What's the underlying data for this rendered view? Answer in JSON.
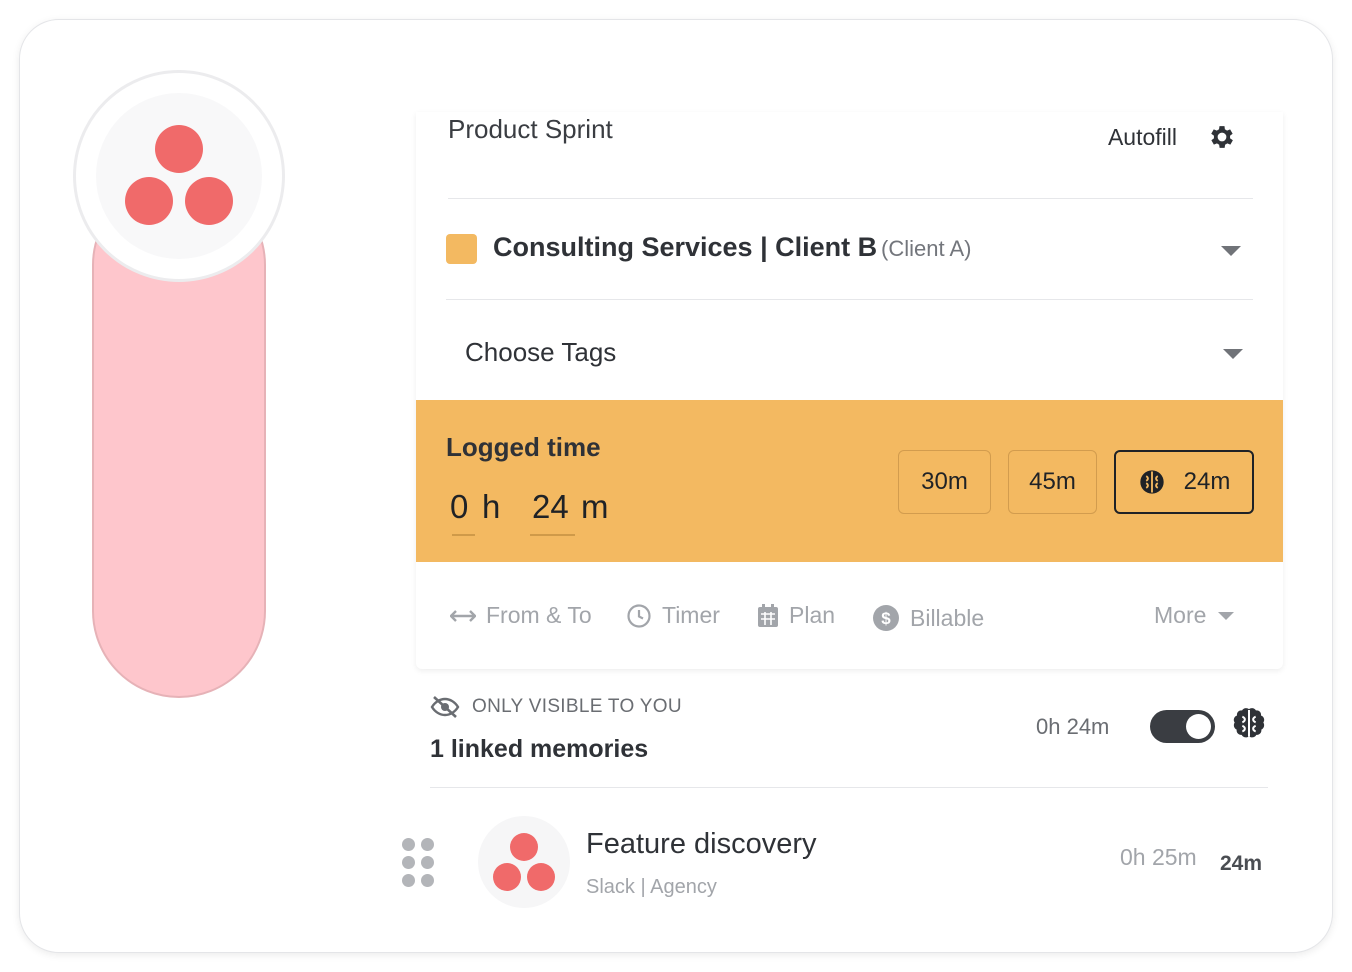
{
  "header": {
    "title": "Product Sprint",
    "autofill_label": "Autofill"
  },
  "project": {
    "name": "Consulting Services | Client B",
    "client": "(Client A)",
    "color": "#f3b961"
  },
  "tags": {
    "placeholder": "Choose Tags"
  },
  "logged_time": {
    "label": "Logged time",
    "hours": "0",
    "hours_unit": "h",
    "minutes": "24",
    "minutes_unit": "m",
    "quick_options": [
      "30m",
      "45m"
    ],
    "suggested": "24m",
    "background": "#f3b961"
  },
  "options": {
    "from_to": "From & To",
    "timer": "Timer",
    "plan": "Plan",
    "billable": "Billable",
    "more": "More"
  },
  "memories": {
    "visibility": "ONLY VISIBLE TO YOU",
    "count_label": "1 linked memories",
    "total": "0h 24m",
    "toggle_on": true,
    "items": [
      {
        "name": "Feature discovery",
        "source": "Slack | Agency",
        "duration": "0h 25m",
        "logged": "24m"
      }
    ]
  },
  "icons": {
    "app_logo": "asana-logo-icon",
    "settings": "gear-icon",
    "memory": "brain-icon"
  },
  "brand": {
    "accent": "#f06a6a",
    "pill": "#fec6cc"
  }
}
